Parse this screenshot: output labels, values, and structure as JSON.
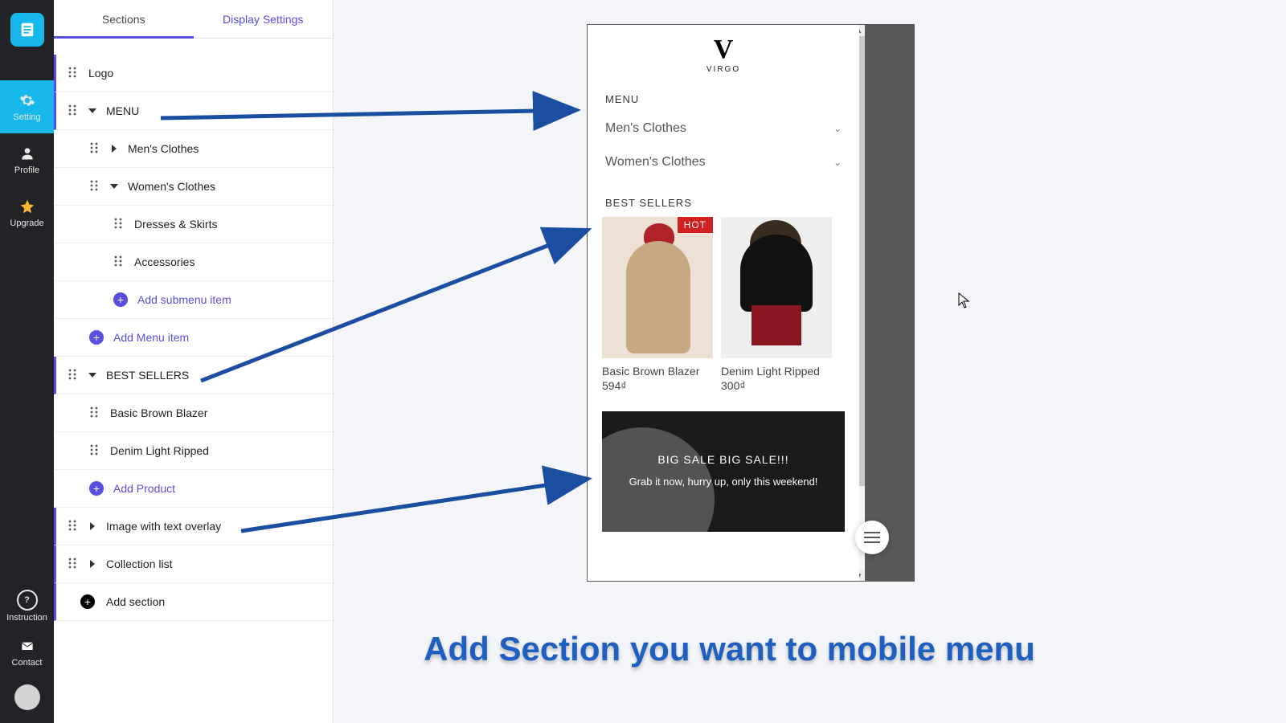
{
  "rail": {
    "items": [
      {
        "id": "setting",
        "label": "Setting",
        "icon": "gear"
      },
      {
        "id": "profile",
        "label": "Profile",
        "icon": "user"
      },
      {
        "id": "upgrade",
        "label": "Upgrade",
        "icon": "star"
      }
    ],
    "bottom": [
      {
        "id": "instruction",
        "label": "Instruction",
        "icon": "question"
      },
      {
        "id": "contact",
        "label": "Contact",
        "icon": "mail"
      }
    ]
  },
  "tabs": {
    "sections": "Sections",
    "display": "Display Settings"
  },
  "tree": {
    "logo": "Logo",
    "menu": "MENU",
    "mens": "Men's Clothes",
    "womens": "Women's Clothes",
    "dresses": "Dresses & Skirts",
    "accessories": "Accessories",
    "add_submenu": "Add submenu item",
    "add_menu": "Add Menu item",
    "best": "BEST SELLERS",
    "p1": "Basic Brown Blazer",
    "p2": "Denim Light Ripped",
    "add_product": "Add Product",
    "image_overlay": "Image with text overlay",
    "collection": "Collection list",
    "add_section": "Add section"
  },
  "preview": {
    "brand": "VIRGO",
    "menu_title": "MENU",
    "menu_items": [
      "Men's Clothes",
      "Women's Clothes"
    ],
    "bs_title": "BEST SELLERS",
    "hot_label": "HOT",
    "products": [
      {
        "name": "Basic Brown Blazer",
        "price": "594₫"
      },
      {
        "name": "Denim Light Ripped",
        "price": "300₫"
      }
    ],
    "banner": {
      "title": "BIG SALE BIG SALE!!!",
      "sub": "Grab it now, hurry up, only this weekend!"
    }
  },
  "caption": "Add Section you want to mobile menu"
}
